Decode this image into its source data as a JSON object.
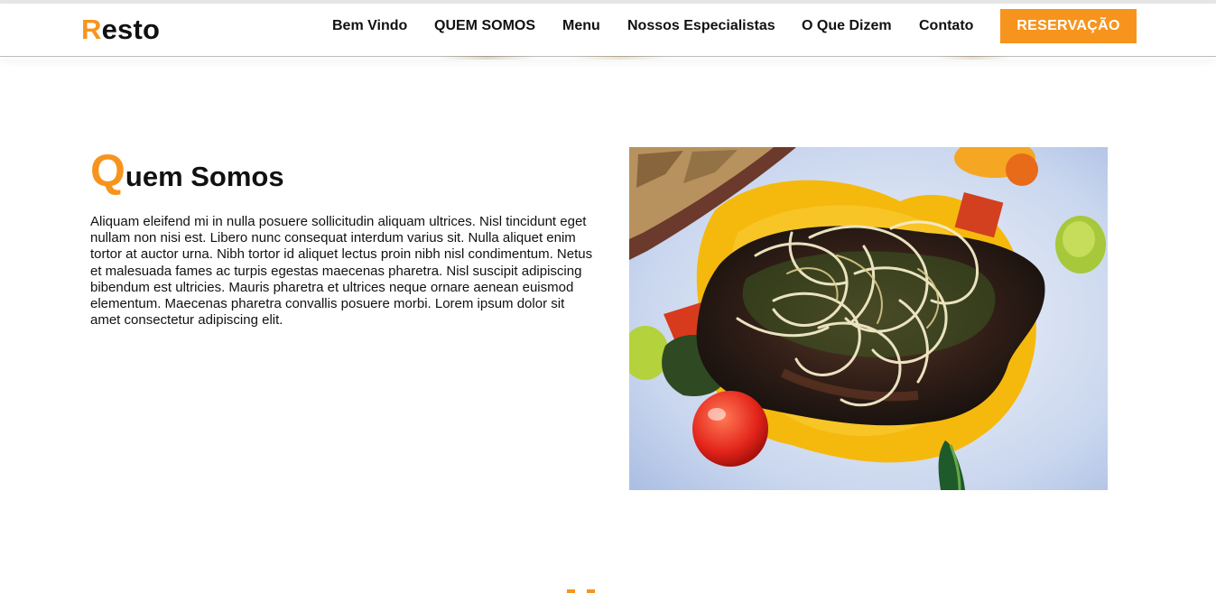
{
  "brand": {
    "first_letter": "R",
    "rest": "esto",
    "accent_color": "#f7941d"
  },
  "nav": {
    "items": [
      {
        "label": "Bem Vindo"
      },
      {
        "label": "QUEM SOMOS"
      },
      {
        "label": "Menu"
      },
      {
        "label": "Nossos Especialistas"
      },
      {
        "label": "O Que Dizem"
      },
      {
        "label": "Contato"
      }
    ],
    "cta_label": "RESERVAÇÃO"
  },
  "about": {
    "title_first": "Q",
    "title_rest": "uem Somos",
    "text": "Aliquam eleifend mi in nulla posuere sollicitudin aliquam ultrices. Nisl tincidunt eget nullam non nisi est. Libero nunc consequat interdum varius sit. Nulla aliquet enim tortor at auctor urna. Nibh tortor id aliquet lectus proin nibh nisl condimentum. Netus et malesuada fames ac turpis egestas maecenas pharetra. Nisl suscipit adipiscing bibendum est ultricies. Mauris pharetra et ultrices neque ornare aenean euismod elementum. Maecenas pharetra convallis posuere morbi. Lorem ipsum dolor sit amet consectetur adipiscing elit."
  }
}
